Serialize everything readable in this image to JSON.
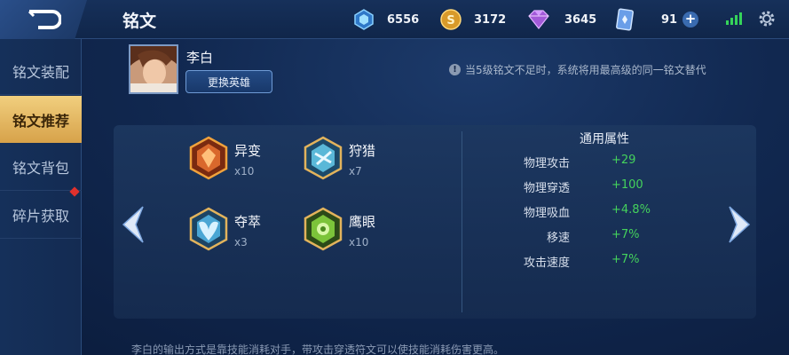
{
  "header": {
    "title": "铭文"
  },
  "currencies": [
    {
      "icon": "diamond-icon",
      "value": "6556"
    },
    {
      "icon": "gold-coin-icon",
      "value": "3172"
    },
    {
      "icon": "crystal-icon",
      "value": "3645"
    },
    {
      "icon": "voucher-card-icon",
      "value": "91"
    }
  ],
  "sidebar": {
    "items": [
      {
        "label": "铭文装配",
        "active": false
      },
      {
        "label": "铭文推荐",
        "active": true
      },
      {
        "label": "铭文背包",
        "active": false
      },
      {
        "label": "碎片获取",
        "active": false
      }
    ]
  },
  "hero": {
    "name": "李白",
    "change_label": "更换英雄"
  },
  "notice": {
    "text": "当5级铭文不足时，系统将用最高级的同一铭文替代"
  },
  "runes": [
    {
      "name": "异变",
      "count": "x10",
      "color": "#d9682c"
    },
    {
      "name": "狩猎",
      "count": "x7",
      "color": "#5ab8d8"
    },
    {
      "name": "夺萃",
      "count": "x3",
      "color": "#4aa6d4"
    },
    {
      "name": "鹰眼",
      "count": "x10",
      "color": "#7cc43a"
    }
  ],
  "attributes": {
    "title": "通用属性",
    "rows": [
      {
        "label": "物理攻击",
        "value": "+29"
      },
      {
        "label": "物理穿透",
        "value": "+100"
      },
      {
        "label": "物理吸血",
        "value": "+4.8%"
      },
      {
        "label": "移速",
        "value": "+7%"
      },
      {
        "label": "攻击速度",
        "value": "+7%"
      }
    ]
  },
  "footer": {
    "note": "李白的输出方式是靠技能消耗对手，带攻击穿透符文可以使技能消耗伤害更高。"
  },
  "colors": {
    "accent_gold": "#e2b35c",
    "attr_value_green": "#44d25c"
  }
}
